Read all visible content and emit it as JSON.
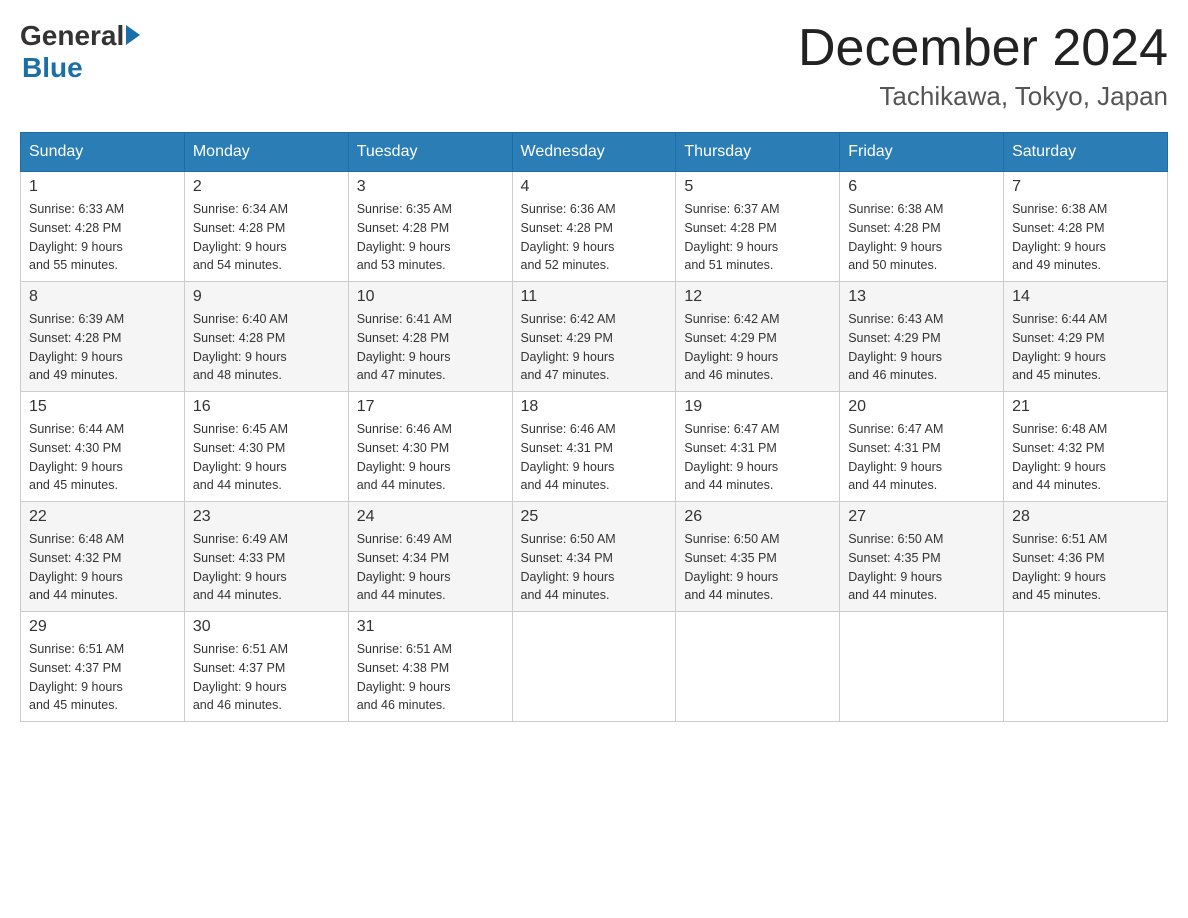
{
  "logo": {
    "general": "General",
    "blue": "Blue"
  },
  "title": "December 2024",
  "location": "Tachikawa, Tokyo, Japan",
  "headers": [
    "Sunday",
    "Monday",
    "Tuesday",
    "Wednesday",
    "Thursday",
    "Friday",
    "Saturday"
  ],
  "weeks": [
    [
      {
        "day": "1",
        "sunrise": "6:33 AM",
        "sunset": "4:28 PM",
        "daylight": "9 hours and 55 minutes."
      },
      {
        "day": "2",
        "sunrise": "6:34 AM",
        "sunset": "4:28 PM",
        "daylight": "9 hours and 54 minutes."
      },
      {
        "day": "3",
        "sunrise": "6:35 AM",
        "sunset": "4:28 PM",
        "daylight": "9 hours and 53 minutes."
      },
      {
        "day": "4",
        "sunrise": "6:36 AM",
        "sunset": "4:28 PM",
        "daylight": "9 hours and 52 minutes."
      },
      {
        "day": "5",
        "sunrise": "6:37 AM",
        "sunset": "4:28 PM",
        "daylight": "9 hours and 51 minutes."
      },
      {
        "day": "6",
        "sunrise": "6:38 AM",
        "sunset": "4:28 PM",
        "daylight": "9 hours and 50 minutes."
      },
      {
        "day": "7",
        "sunrise": "6:38 AM",
        "sunset": "4:28 PM",
        "daylight": "9 hours and 49 minutes."
      }
    ],
    [
      {
        "day": "8",
        "sunrise": "6:39 AM",
        "sunset": "4:28 PM",
        "daylight": "9 hours and 49 minutes."
      },
      {
        "day": "9",
        "sunrise": "6:40 AM",
        "sunset": "4:28 PM",
        "daylight": "9 hours and 48 minutes."
      },
      {
        "day": "10",
        "sunrise": "6:41 AM",
        "sunset": "4:28 PM",
        "daylight": "9 hours and 47 minutes."
      },
      {
        "day": "11",
        "sunrise": "6:42 AM",
        "sunset": "4:29 PM",
        "daylight": "9 hours and 47 minutes."
      },
      {
        "day": "12",
        "sunrise": "6:42 AM",
        "sunset": "4:29 PM",
        "daylight": "9 hours and 46 minutes."
      },
      {
        "day": "13",
        "sunrise": "6:43 AM",
        "sunset": "4:29 PM",
        "daylight": "9 hours and 46 minutes."
      },
      {
        "day": "14",
        "sunrise": "6:44 AM",
        "sunset": "4:29 PM",
        "daylight": "9 hours and 45 minutes."
      }
    ],
    [
      {
        "day": "15",
        "sunrise": "6:44 AM",
        "sunset": "4:30 PM",
        "daylight": "9 hours and 45 minutes."
      },
      {
        "day": "16",
        "sunrise": "6:45 AM",
        "sunset": "4:30 PM",
        "daylight": "9 hours and 44 minutes."
      },
      {
        "day": "17",
        "sunrise": "6:46 AM",
        "sunset": "4:30 PM",
        "daylight": "9 hours and 44 minutes."
      },
      {
        "day": "18",
        "sunrise": "6:46 AM",
        "sunset": "4:31 PM",
        "daylight": "9 hours and 44 minutes."
      },
      {
        "day": "19",
        "sunrise": "6:47 AM",
        "sunset": "4:31 PM",
        "daylight": "9 hours and 44 minutes."
      },
      {
        "day": "20",
        "sunrise": "6:47 AM",
        "sunset": "4:31 PM",
        "daylight": "9 hours and 44 minutes."
      },
      {
        "day": "21",
        "sunrise": "6:48 AM",
        "sunset": "4:32 PM",
        "daylight": "9 hours and 44 minutes."
      }
    ],
    [
      {
        "day": "22",
        "sunrise": "6:48 AM",
        "sunset": "4:32 PM",
        "daylight": "9 hours and 44 minutes."
      },
      {
        "day": "23",
        "sunrise": "6:49 AM",
        "sunset": "4:33 PM",
        "daylight": "9 hours and 44 minutes."
      },
      {
        "day": "24",
        "sunrise": "6:49 AM",
        "sunset": "4:34 PM",
        "daylight": "9 hours and 44 minutes."
      },
      {
        "day": "25",
        "sunrise": "6:50 AM",
        "sunset": "4:34 PM",
        "daylight": "9 hours and 44 minutes."
      },
      {
        "day": "26",
        "sunrise": "6:50 AM",
        "sunset": "4:35 PM",
        "daylight": "9 hours and 44 minutes."
      },
      {
        "day": "27",
        "sunrise": "6:50 AM",
        "sunset": "4:35 PM",
        "daylight": "9 hours and 44 minutes."
      },
      {
        "day": "28",
        "sunrise": "6:51 AM",
        "sunset": "4:36 PM",
        "daylight": "9 hours and 45 minutes."
      }
    ],
    [
      {
        "day": "29",
        "sunrise": "6:51 AM",
        "sunset": "4:37 PM",
        "daylight": "9 hours and 45 minutes."
      },
      {
        "day": "30",
        "sunrise": "6:51 AM",
        "sunset": "4:37 PM",
        "daylight": "9 hours and 46 minutes."
      },
      {
        "day": "31",
        "sunrise": "6:51 AM",
        "sunset": "4:38 PM",
        "daylight": "9 hours and 46 minutes."
      },
      null,
      null,
      null,
      null
    ]
  ]
}
